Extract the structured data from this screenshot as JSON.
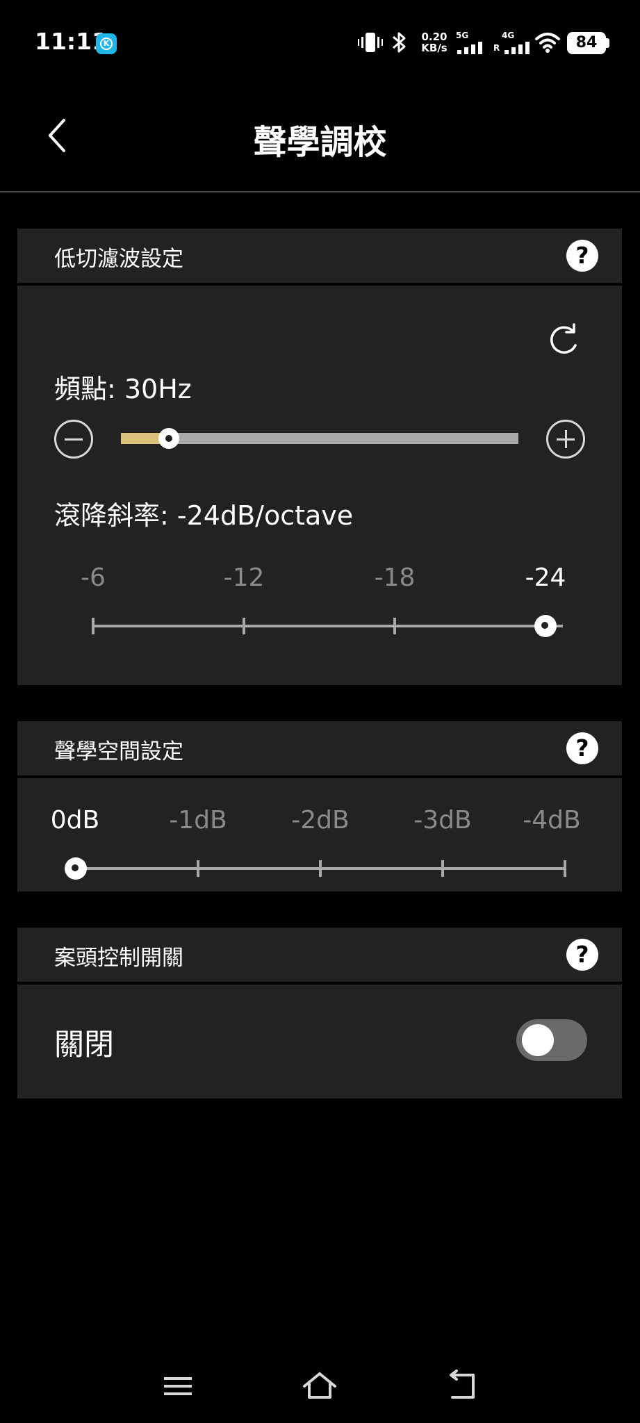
{
  "status_bar": {
    "time": "11:11",
    "net_speed_value": "0.20",
    "net_speed_unit": "KB/s",
    "net_5g": "5G",
    "net_4g": "4G",
    "roaming": "R",
    "battery": "84"
  },
  "header": {
    "title": "聲學調校"
  },
  "low_cut": {
    "section_title": "低切濾波設定",
    "help_label": "?",
    "frequency_label": "頻點: 30Hz",
    "frequency_slider_level": 0.12,
    "rolloff_label": "滾降斜率: -24dB/octave",
    "rolloff_options": [
      "-6",
      "-12",
      "-18",
      "-24"
    ],
    "rolloff_selected_index": 3
  },
  "acoustic_space": {
    "section_title": "聲學空間設定",
    "help_label": "?",
    "options": [
      "0dB",
      "-1dB",
      "-2dB",
      "-3dB",
      "-4dB"
    ],
    "selected_index": 0
  },
  "desktop_control": {
    "section_title": "案頭控制開關",
    "help_label": "?",
    "state_label": "關閉",
    "enabled": false
  },
  "colors": {
    "background": "#000000",
    "panel": "#222222",
    "accent": "#dcc17c",
    "track": "#a9a9a9"
  }
}
